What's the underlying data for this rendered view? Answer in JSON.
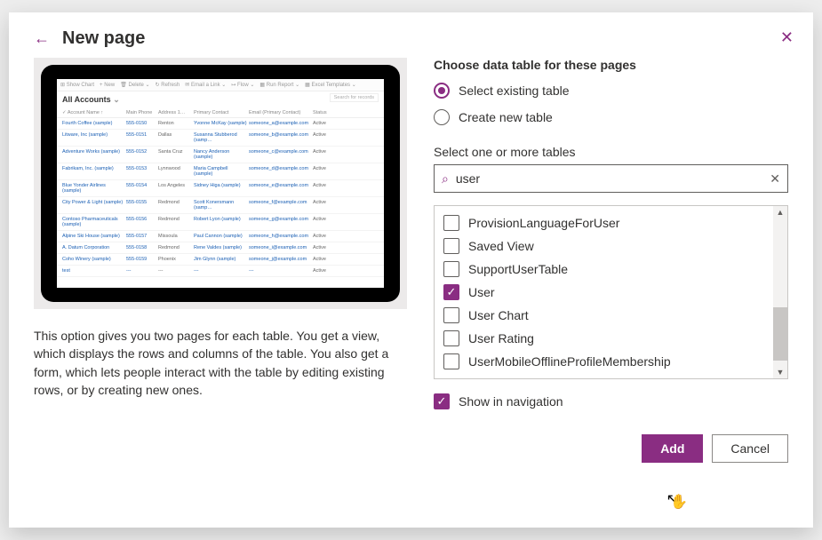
{
  "header": {
    "title": "New page"
  },
  "left": {
    "description": "This option gives you two pages for each table. You get a view, which displays the rows and columns of the table. You also get a form, which lets people interact with the table by editing existing rows, or by creating new ones.",
    "preview": {
      "toolbar": [
        "⊞ Show Chart",
        "+ New",
        "🗑 Delete ⌄",
        "↻ Refresh",
        "✉ Email a Link ⌄",
        "↦ Flow ⌄",
        "▦ Run Report ⌄",
        "▦ Excel Templates ⌄"
      ],
      "list_title": "All Accounts",
      "search_placeholder": "Search for records",
      "columns": [
        "✓  Account Name ↑",
        "Main Phone",
        "Address 1…",
        "Primary Contact",
        "Email (Primary Contact)",
        "Status"
      ],
      "rows": [
        {
          "c1": "Fourth Coffee (sample)",
          "c2": "555-0150",
          "c3": "Renton",
          "c4": "Yvonne McKay (sample)",
          "c5": "someone_a@example.com",
          "c6": "Active"
        },
        {
          "c1": "Litware, Inc (sample)",
          "c2": "555-0151",
          "c3": "Dallas",
          "c4": "Susanna Stubberod (samp…",
          "c5": "someone_b@example.com",
          "c6": "Active"
        },
        {
          "c1": "Adventure Works (sample)",
          "c2": "555-0152",
          "c3": "Santa Cruz",
          "c4": "Nancy Anderson (sample)",
          "c5": "someone_c@example.com",
          "c6": "Active"
        },
        {
          "c1": "Fabrikam, Inc. (sample)",
          "c2": "555-0153",
          "c3": "Lynnwood",
          "c4": "Maria Campbell (sample)",
          "c5": "someone_d@example.com",
          "c6": "Active"
        },
        {
          "c1": "Blue Yonder Airlines (sample)",
          "c2": "555-0154",
          "c3": "Los Angeles",
          "c4": "Sidney Higa (sample)",
          "c5": "someone_e@example.com",
          "c6": "Active"
        },
        {
          "c1": "City Power & Light (sample)",
          "c2": "555-0155",
          "c3": "Redmond",
          "c4": "Scott Konersmann (samp…",
          "c5": "someone_f@example.com",
          "c6": "Active"
        },
        {
          "c1": "Contoso Pharmaceuticals (sample)",
          "c2": "555-0156",
          "c3": "Redmond",
          "c4": "Robert Lyon (sample)",
          "c5": "someone_g@example.com",
          "c6": "Active"
        },
        {
          "c1": "Alpine Ski House (sample)",
          "c2": "555-0157",
          "c3": "Missoula",
          "c4": "Paul Cannon (sample)",
          "c5": "someone_h@example.com",
          "c6": "Active"
        },
        {
          "c1": "A. Datum Corporation",
          "c2": "555-0158",
          "c3": "Redmond",
          "c4": "Rene Valdes (sample)",
          "c5": "someone_i@example.com",
          "c6": "Active"
        },
        {
          "c1": "Coho Winery (sample)",
          "c2": "555-0159",
          "c3": "Phoenix",
          "c4": "Jim Glynn (sample)",
          "c5": "someone_j@example.com",
          "c6": "Active"
        },
        {
          "c1": "test",
          "c2": "---",
          "c3": "---",
          "c4": "---",
          "c5": "---",
          "c6": "Active"
        }
      ]
    }
  },
  "right": {
    "choose_label": "Choose data table for these pages",
    "radio_existing": "Select existing table",
    "radio_new": "Create new table",
    "select_label": "Select one or more tables",
    "search_value": "user",
    "tables": [
      {
        "label": "ProvisionLanguageForUser",
        "checked": false
      },
      {
        "label": "Saved View",
        "checked": false
      },
      {
        "label": "SupportUserTable",
        "checked": false
      },
      {
        "label": "User",
        "checked": true
      },
      {
        "label": "User Chart",
        "checked": false
      },
      {
        "label": "User Rating",
        "checked": false
      },
      {
        "label": "UserMobileOfflineProfileMembership",
        "checked": false
      }
    ],
    "show_nav_label": "Show in navigation",
    "show_nav_checked": true
  },
  "footer": {
    "add_label": "Add",
    "cancel_label": "Cancel"
  }
}
